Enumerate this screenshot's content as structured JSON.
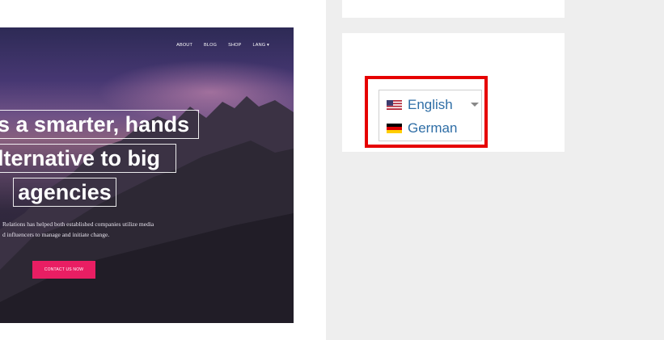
{
  "hero": {
    "nav": [
      "ABOUT",
      "BLOG",
      "SHOP",
      "LANG ▾"
    ],
    "headline": [
      "s a smarter, hands",
      "lternative to big",
      "agencies"
    ],
    "subtext": [
      "Relations has helped both established companies utilize media",
      "d influencers to manage and initiate change."
    ],
    "cta_label": "CONTACT US NOW"
  },
  "language_switcher": {
    "languages": [
      {
        "label": "English",
        "flag": "us-flag-icon"
      },
      {
        "label": "German",
        "flag": "de-flag-icon"
      }
    ],
    "dropdown_icon": "caret-down-icon",
    "highlight_color": "#e60000"
  },
  "colors": {
    "accent": "#e91e63",
    "link": "#2f6ea6",
    "sidebar_bg": "#eeeeee"
  }
}
